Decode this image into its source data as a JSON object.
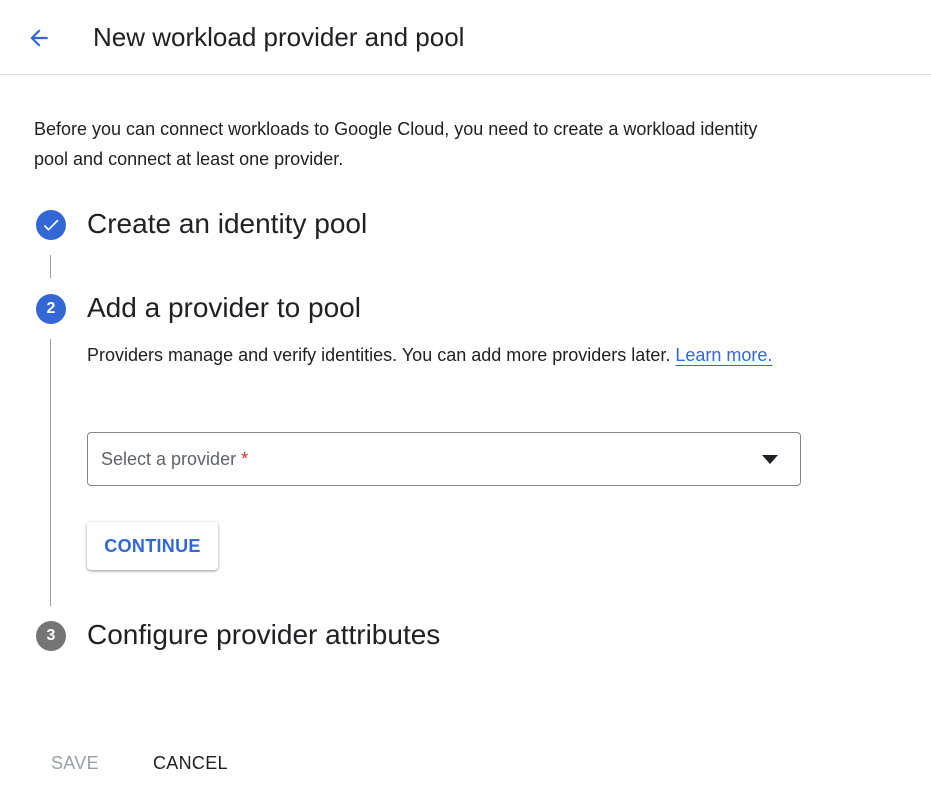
{
  "header": {
    "back_icon": "arrow-left-icon",
    "title": "New workload provider and pool"
  },
  "intro": {
    "text": "Before you can connect workloads to Google Cloud, you need to create a workload identity pool and connect at least one provider."
  },
  "steps": [
    {
      "state": "completed",
      "icon": "check-icon",
      "title": "Create an identity pool"
    },
    {
      "state": "active",
      "number": "2",
      "title": "Add a provider to pool",
      "description": "Providers manage and verify identities. You can add more providers later.",
      "learn_more": "Learn more.",
      "select": {
        "placeholder": "Select a provider",
        "required_mark": "*",
        "arrow_icon": "dropdown-arrow-icon"
      },
      "continue_label": "CONTINUE"
    },
    {
      "state": "pending",
      "number": "3",
      "title": "Configure provider attributes"
    }
  ],
  "footer": {
    "save_label": "SAVE",
    "cancel_label": "CANCEL"
  },
  "colors": {
    "accent": "#3367d6",
    "pending_step": "#757575",
    "required": "#d93025",
    "disabled_text": "#9aa0a6"
  }
}
